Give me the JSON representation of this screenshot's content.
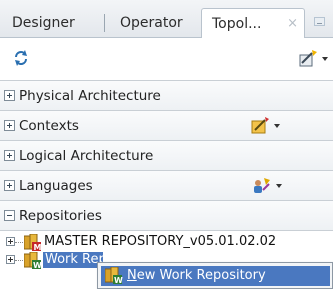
{
  "tabs": {
    "designer": "Designer",
    "operator": "Operator",
    "topology": "Topol...",
    "close_glyph": "×"
  },
  "accordion": [
    {
      "label": "Physical Architecture",
      "expanded": false
    },
    {
      "label": "Contexts",
      "expanded": false
    },
    {
      "label": "Logical Architecture",
      "expanded": false
    },
    {
      "label": "Languages",
      "expanded": false
    },
    {
      "label": "Repositories",
      "expanded": true
    }
  ],
  "tree": {
    "master": {
      "label": "MASTER REPOSITORY_v05.01.02.02",
      "badge": "M"
    },
    "work": {
      "label": "Work Repositories",
      "badge": "W",
      "selected": true
    }
  },
  "context_menu": {
    "item": "New Work Repository",
    "mnemonic": "N"
  },
  "colors": {
    "selection": "#4a78c0",
    "badge_master": "#c62828",
    "badge_work": "#2e7d32"
  }
}
